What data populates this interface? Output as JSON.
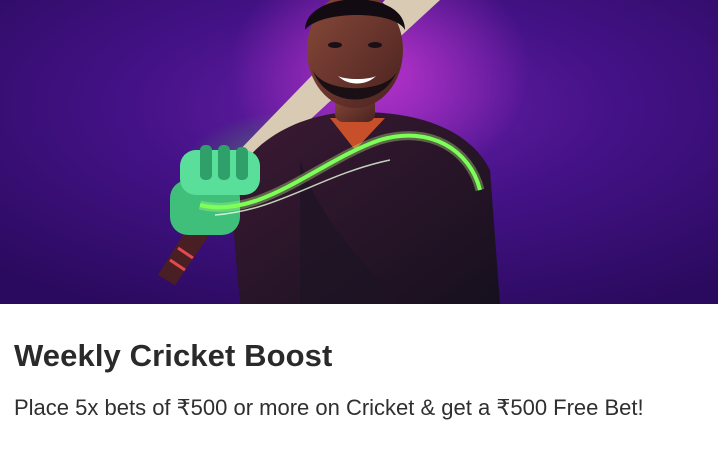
{
  "promo": {
    "title": "Weekly Cricket Boost",
    "description": "Place 5x bets of ₹500 or more on Cricket & get a ₹500 Free Bet!"
  },
  "banner": {
    "subject": "cricket-player-with-bat",
    "colors": {
      "background": "#3a0f7a",
      "glow_green": "#5dff5a",
      "glow_pink": "#c72bd1"
    }
  }
}
